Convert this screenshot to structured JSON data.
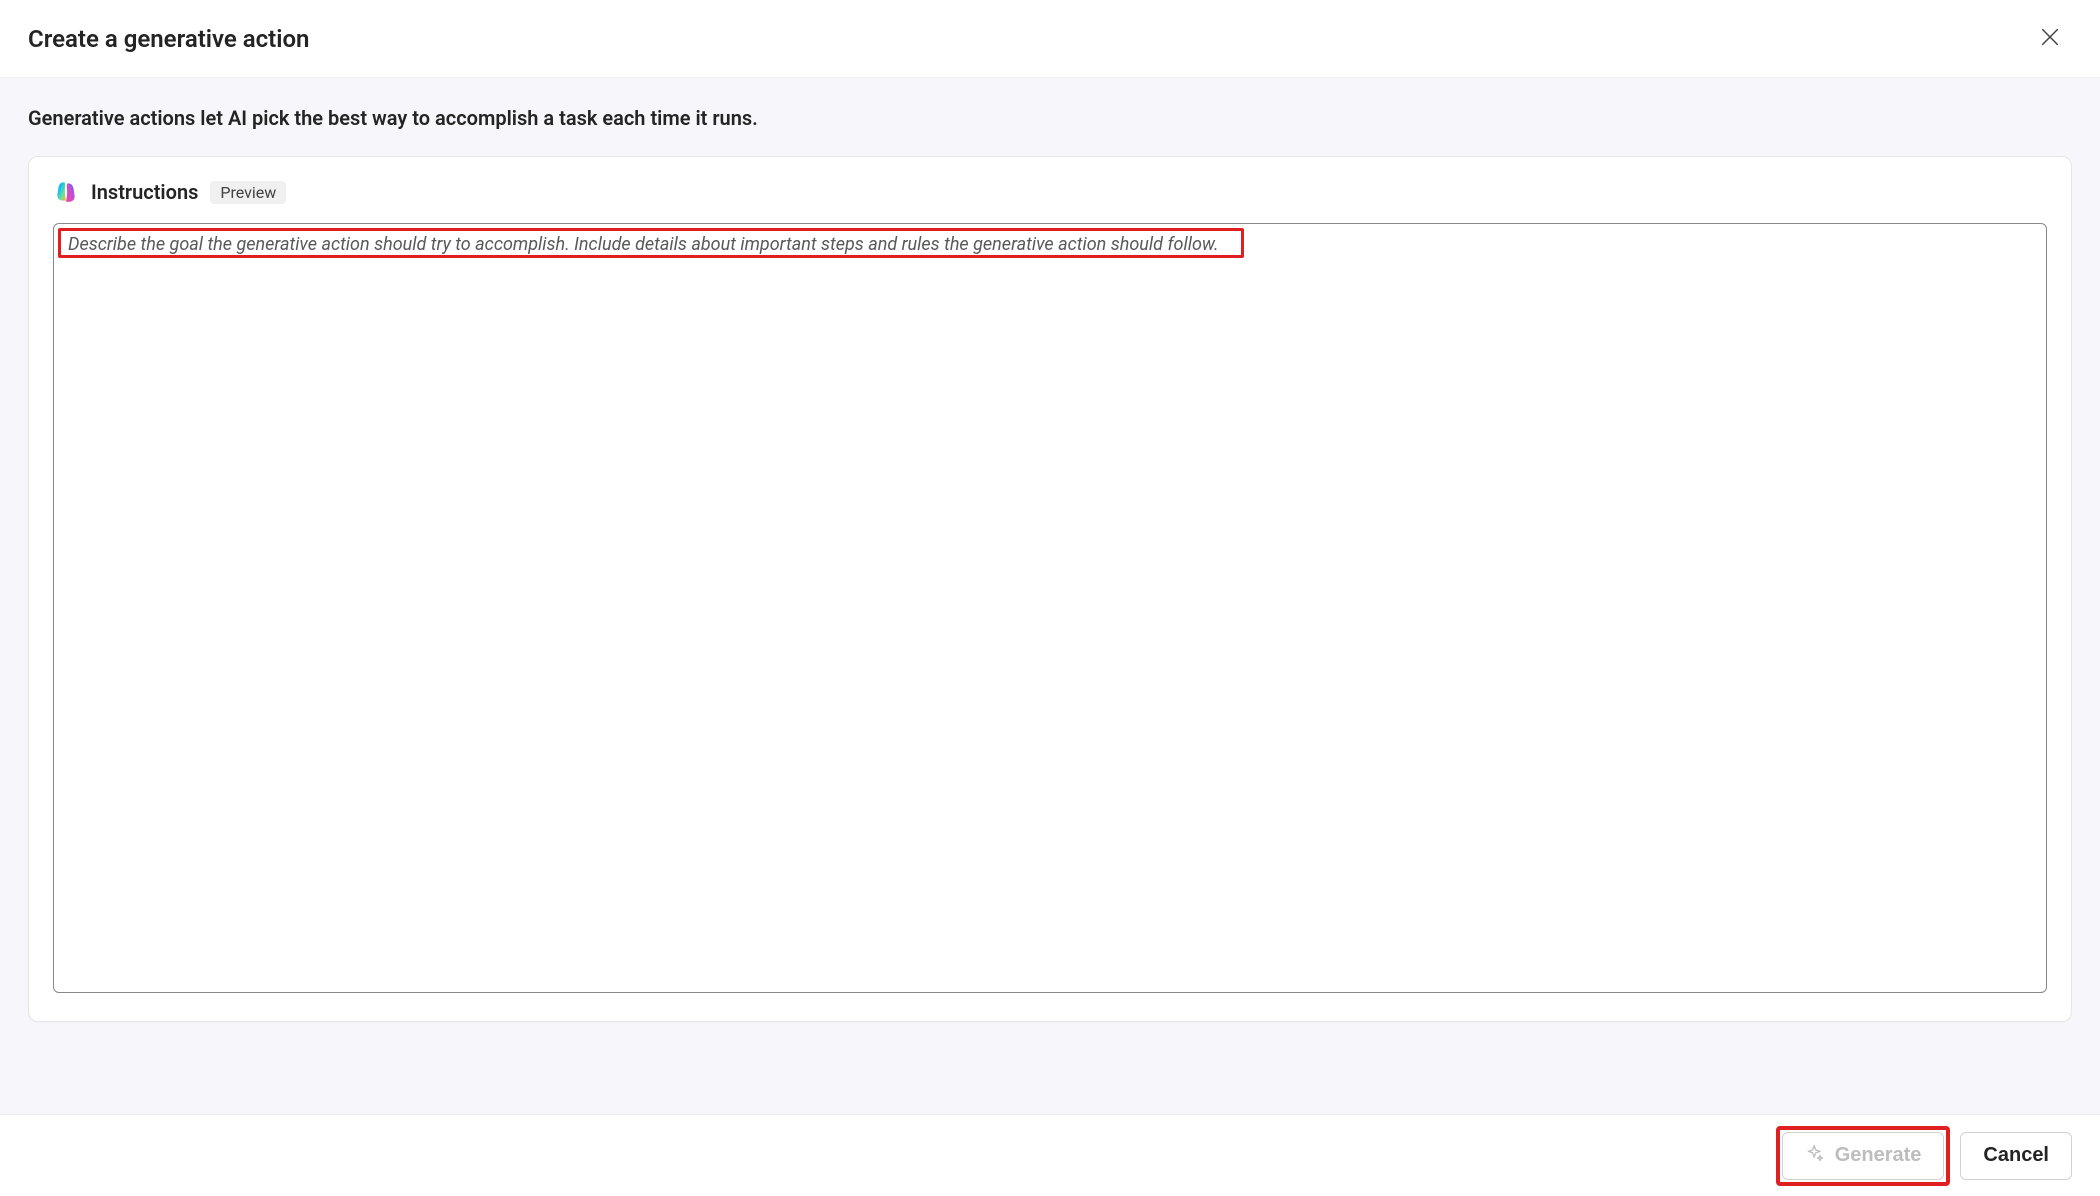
{
  "header": {
    "title": "Create a generative action"
  },
  "subtitle": "Generative actions let AI pick the best way to accomplish a task each time it runs.",
  "card": {
    "title": "Instructions",
    "badge": "Preview",
    "placeholder": "Describe the goal the generative action should try to accomplish. Include details about important steps and rules the generative action should follow.",
    "value": ""
  },
  "footer": {
    "generate_label": "Generate",
    "cancel_label": "Cancel"
  }
}
